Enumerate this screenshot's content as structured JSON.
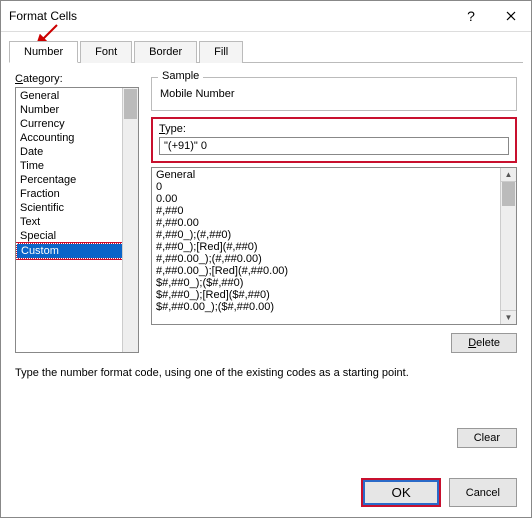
{
  "title": "Format Cells",
  "tabs": {
    "number": "Number",
    "font": "Font",
    "border": "Border",
    "fill": "Fill"
  },
  "left": {
    "label": "Category:",
    "items": [
      "General",
      "Number",
      "Currency",
      "Accounting",
      "Date",
      "Time",
      "Percentage",
      "Fraction",
      "Scientific",
      "Text",
      "Special",
      "Custom"
    ],
    "selected": "Custom"
  },
  "right": {
    "sample_label": "Sample",
    "sample_value": "Mobile Number",
    "type_label": "Type:",
    "type_value": "\"(+91)\" 0",
    "formats": [
      "General",
      "0",
      "0.00",
      "#,##0",
      "#,##0.00",
      "#,##0_);(#,##0)",
      "#,##0_);[Red](#,##0)",
      "#,##0.00_);(#,##0.00)",
      "#,##0.00_);[Red](#,##0.00)",
      "$#,##0_);($#,##0)",
      "$#,##0_);[Red]($#,##0)",
      "$#,##0.00_);($#,##0.00)"
    ],
    "delete_btn": "Delete"
  },
  "hint": "Type the number format code, using one of the existing codes as a starting point.",
  "footer": {
    "clear": "Clear",
    "ok": "OK",
    "cancel": "Cancel"
  }
}
